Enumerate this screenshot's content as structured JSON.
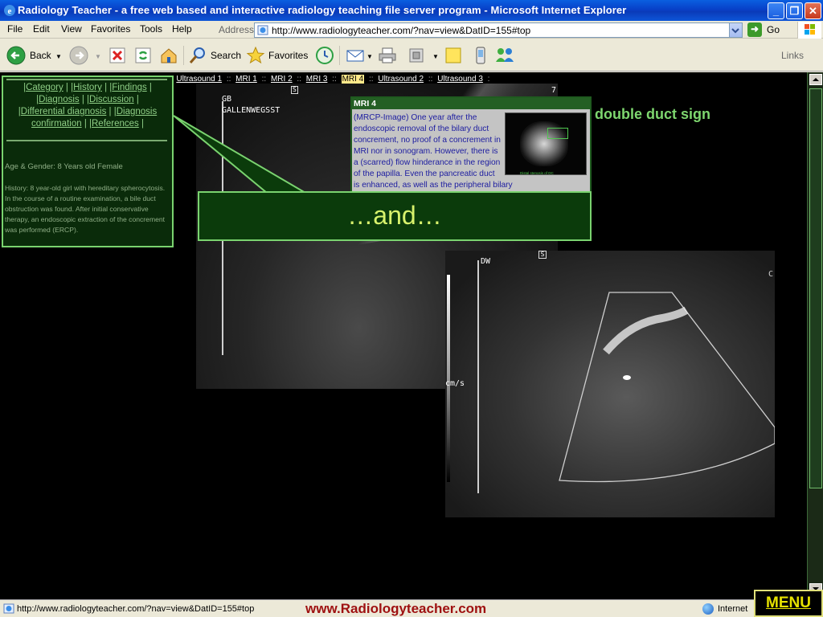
{
  "window": {
    "title": "Radiology Teacher - a free web based and interactive radiology teaching file server program - Microsoft Internet Explorer",
    "minimize": "_",
    "maximize": "❐",
    "close": "✕"
  },
  "menu": [
    "File",
    "Edit",
    "View",
    "Favorites",
    "Tools",
    "Help"
  ],
  "address": {
    "label": "Address",
    "url": "http://www.radiologyteacher.com/?nav=view&DatID=155#top",
    "go_label": "Go"
  },
  "toolbar": {
    "back": "Back",
    "search": "Search",
    "favorites": "Favorites",
    "links": "Links"
  },
  "breadcrumb": {
    "items": [
      "Ultrasound 1",
      "MRI 1",
      "MRI 2",
      "MRI 3",
      "MRI 4",
      "Ultrasound 2",
      "Ultrasound 3"
    ],
    "current": "MRI 4"
  },
  "info": {
    "links_line1": [
      "Category",
      "History",
      "Findings"
    ],
    "links_line2": [
      "Diagnosis",
      "Discussion"
    ],
    "links_line3": [
      "Differential diagnosis",
      "Diagnosis"
    ],
    "links_line4": [
      "confirmation",
      "References"
    ],
    "age_gender": "Age & Gender: 8 Years old Female",
    "history": "History: 8 year-old girl with hereditary spherocytosis. In the course of a routine examination, a bile duct obstruction was found. After initial conservative therapy, an endoscopic extraction of the concrement was performed (ERCP)."
  },
  "us1": {
    "label_gb": "GB",
    "label_name": "GALLENWEGSST",
    "marker_s": "S",
    "marker_7": "7"
  },
  "us2": {
    "label_dw": "DW",
    "marker_s": "S",
    "label_cms": "cm/s",
    "label_c": "C"
  },
  "mri_popup": {
    "title": "MRI 4",
    "text": "(MRCP-Image) One year after the endoscopic removal of the bilary duct concrement, no proof of a concrement in MRI nor in sonogram. However, there is a (scarred) flow hinderance in the region of the papilla. Even the pancreatic duct is enhanced, as well as the peripheral bilary",
    "thumb_caption": "Distal stenosis of DC"
  },
  "double_duct": "double duct sign",
  "callout": "…and…",
  "menu_button": "MENU",
  "status": {
    "url": "http://www.radiologyteacher.com/?nav=view&DatID=155#top",
    "brand": "www.Radiologyteacher.com",
    "zone": "Internet"
  },
  "colors": {
    "panel_border": "#7ad36f",
    "panel_bg": "#0a2b0a",
    "callout_text": "#d8f26c",
    "brand_red": "#9e1010"
  }
}
